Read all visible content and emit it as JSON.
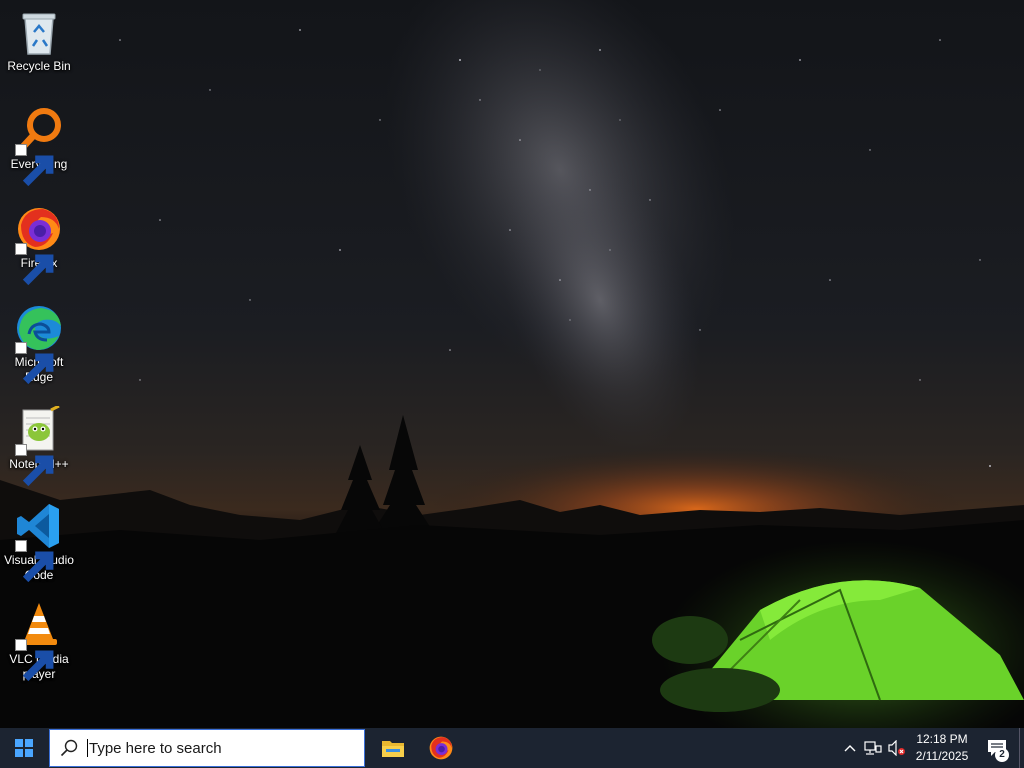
{
  "desktop": {
    "icons": [
      {
        "label": "Recycle Bin",
        "icon": "recycle-bin-icon"
      },
      {
        "label": "Everything",
        "icon": "everything-search-icon"
      },
      {
        "label": "Firefox",
        "icon": "firefox-icon"
      },
      {
        "label": "Microsoft Edge",
        "icon": "edge-icon"
      },
      {
        "label": "Notepad++",
        "icon": "notepad-plus-plus-icon"
      },
      {
        "label": "Visual Studio Code",
        "icon": "vscode-icon"
      },
      {
        "label": "VLC media player",
        "icon": "vlc-icon"
      }
    ]
  },
  "taskbar": {
    "search_placeholder": "Type here to search",
    "pinned": [
      {
        "name": "File Explorer",
        "icon": "file-explorer-icon"
      },
      {
        "name": "Firefox",
        "icon": "firefox-icon"
      }
    ],
    "clock": {
      "time": "12:18 PM",
      "date": "2/11/2025"
    },
    "notification_count": "2",
    "colors": {
      "taskbar": "#1c2431",
      "search_border": "#3a6fd8",
      "start": "#4aa6ff"
    }
  }
}
